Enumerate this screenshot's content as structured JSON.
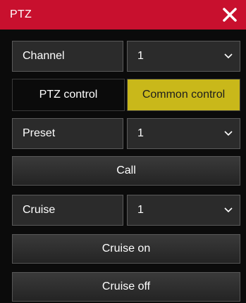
{
  "window": {
    "title": "PTZ",
    "close_icon": "close-icon"
  },
  "channel": {
    "label": "Channel",
    "value": "1"
  },
  "tabs": [
    {
      "label": "PTZ control",
      "active": false
    },
    {
      "label": "Common control",
      "active": true
    }
  ],
  "preset": {
    "label": "Preset",
    "value": "1",
    "action_label": "Call"
  },
  "cruise": {
    "label": "Cruise",
    "value": "1",
    "on_label": "Cruise on",
    "off_label": "Cruise off"
  },
  "colors": {
    "titlebar": "#c8102e",
    "active_tab": "#c9b81a",
    "background": "#0b0b0b"
  }
}
